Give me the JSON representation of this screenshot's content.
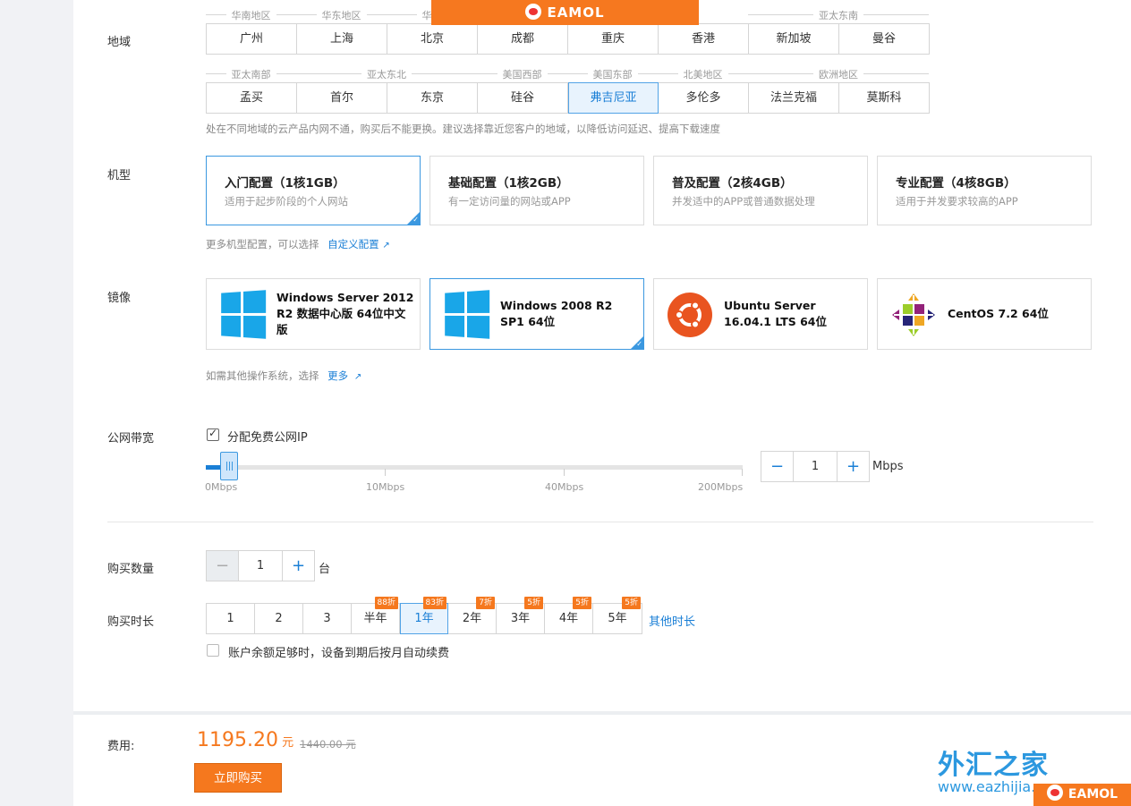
{
  "watermark": {
    "top_text": "EAMOL",
    "bottom_text": "EAMOL"
  },
  "brand": {
    "name": "外汇之家",
    "url": "www.eazhijia.com"
  },
  "region": {
    "label": "地域",
    "groups_row1": [
      "华南地区",
      "华东地区",
      "华北",
      "亚太东南"
    ],
    "cities_row1": [
      "广州",
      "上海",
      "北京",
      "成都",
      "重庆",
      "香港",
      "新加坡",
      "曼谷"
    ],
    "groups_row2": [
      "亚太南部",
      "亚太东北",
      "美国西部",
      "美国东部",
      "北美地区",
      "欧洲地区"
    ],
    "cities_row2": [
      "孟买",
      "首尔",
      "东京",
      "硅谷",
      "弗吉尼亚",
      "多伦多",
      "法兰克福",
      "莫斯科"
    ],
    "selected": "弗吉尼亚",
    "hint": "处在不同地域的云产品内网不通，购买后不能更换。建议选择靠近您客户的地域，以降低访问延迟、提高下载速度"
  },
  "model": {
    "label": "机型",
    "cards": [
      {
        "title": "入门配置（1核1GB）",
        "desc": "适用于起步阶段的个人网站"
      },
      {
        "title": "基础配置（1核2GB）",
        "desc": "有一定访问量的网站或APP"
      },
      {
        "title": "普及配置（2核4GB）",
        "desc": "并发适中的APP或普通数据处理"
      },
      {
        "title": "专业配置（4核8GB）",
        "desc": "适用于并发要求较高的APP"
      }
    ],
    "selected_index": 0,
    "more_text": "更多机型配置，可以选择",
    "more_link": "自定义配置"
  },
  "image": {
    "label": "镜像",
    "cards": [
      {
        "name": "Windows Server 2012 R2 数据中心版 64位中文版",
        "icon": "windows-icon"
      },
      {
        "name": "Windows 2008 R2 SP1 64位",
        "icon": "windows-icon"
      },
      {
        "name": "Ubuntu Server 16.04.1 LTS 64位",
        "icon": "ubuntu-icon"
      },
      {
        "name": "CentOS 7.2 64位",
        "icon": "centos-icon"
      }
    ],
    "selected_index": 1,
    "more_text": "如需其他操作系统，选择",
    "more_link": "更多"
  },
  "bandwidth": {
    "label": "公网带宽",
    "checkbox_label": "分配免费公网IP",
    "checked": true,
    "ticks": [
      "0Mbps",
      "10Mbps",
      "40Mbps",
      "200Mbps"
    ],
    "value": "1",
    "unit": "Mbps",
    "minus": "−",
    "plus": "+"
  },
  "quantity": {
    "label": "购买数量",
    "value": "1",
    "unit": "台",
    "minus": "−",
    "plus": "+"
  },
  "duration": {
    "label": "购买时长",
    "options": [
      {
        "label": "1",
        "badge": ""
      },
      {
        "label": "2",
        "badge": ""
      },
      {
        "label": "3",
        "badge": ""
      },
      {
        "label": "半年",
        "badge": "88折"
      },
      {
        "label": "1年",
        "badge": "83折"
      },
      {
        "label": "2年",
        "badge": "7折"
      },
      {
        "label": "3年",
        "badge": "5折"
      },
      {
        "label": "4年",
        "badge": "5折"
      },
      {
        "label": "5年",
        "badge": "5折"
      }
    ],
    "selected": "1年",
    "other_link": "其他时长",
    "auto_renew": "账户余额足够时，设备到期后按月自动续费"
  },
  "cost": {
    "label": "费用:",
    "price": "1195.20",
    "currency": "元",
    "original": "1440.00 元",
    "buy_button": "立即购买"
  },
  "colors": {
    "accent": "#1a7fd6",
    "orange": "#f5781e"
  }
}
